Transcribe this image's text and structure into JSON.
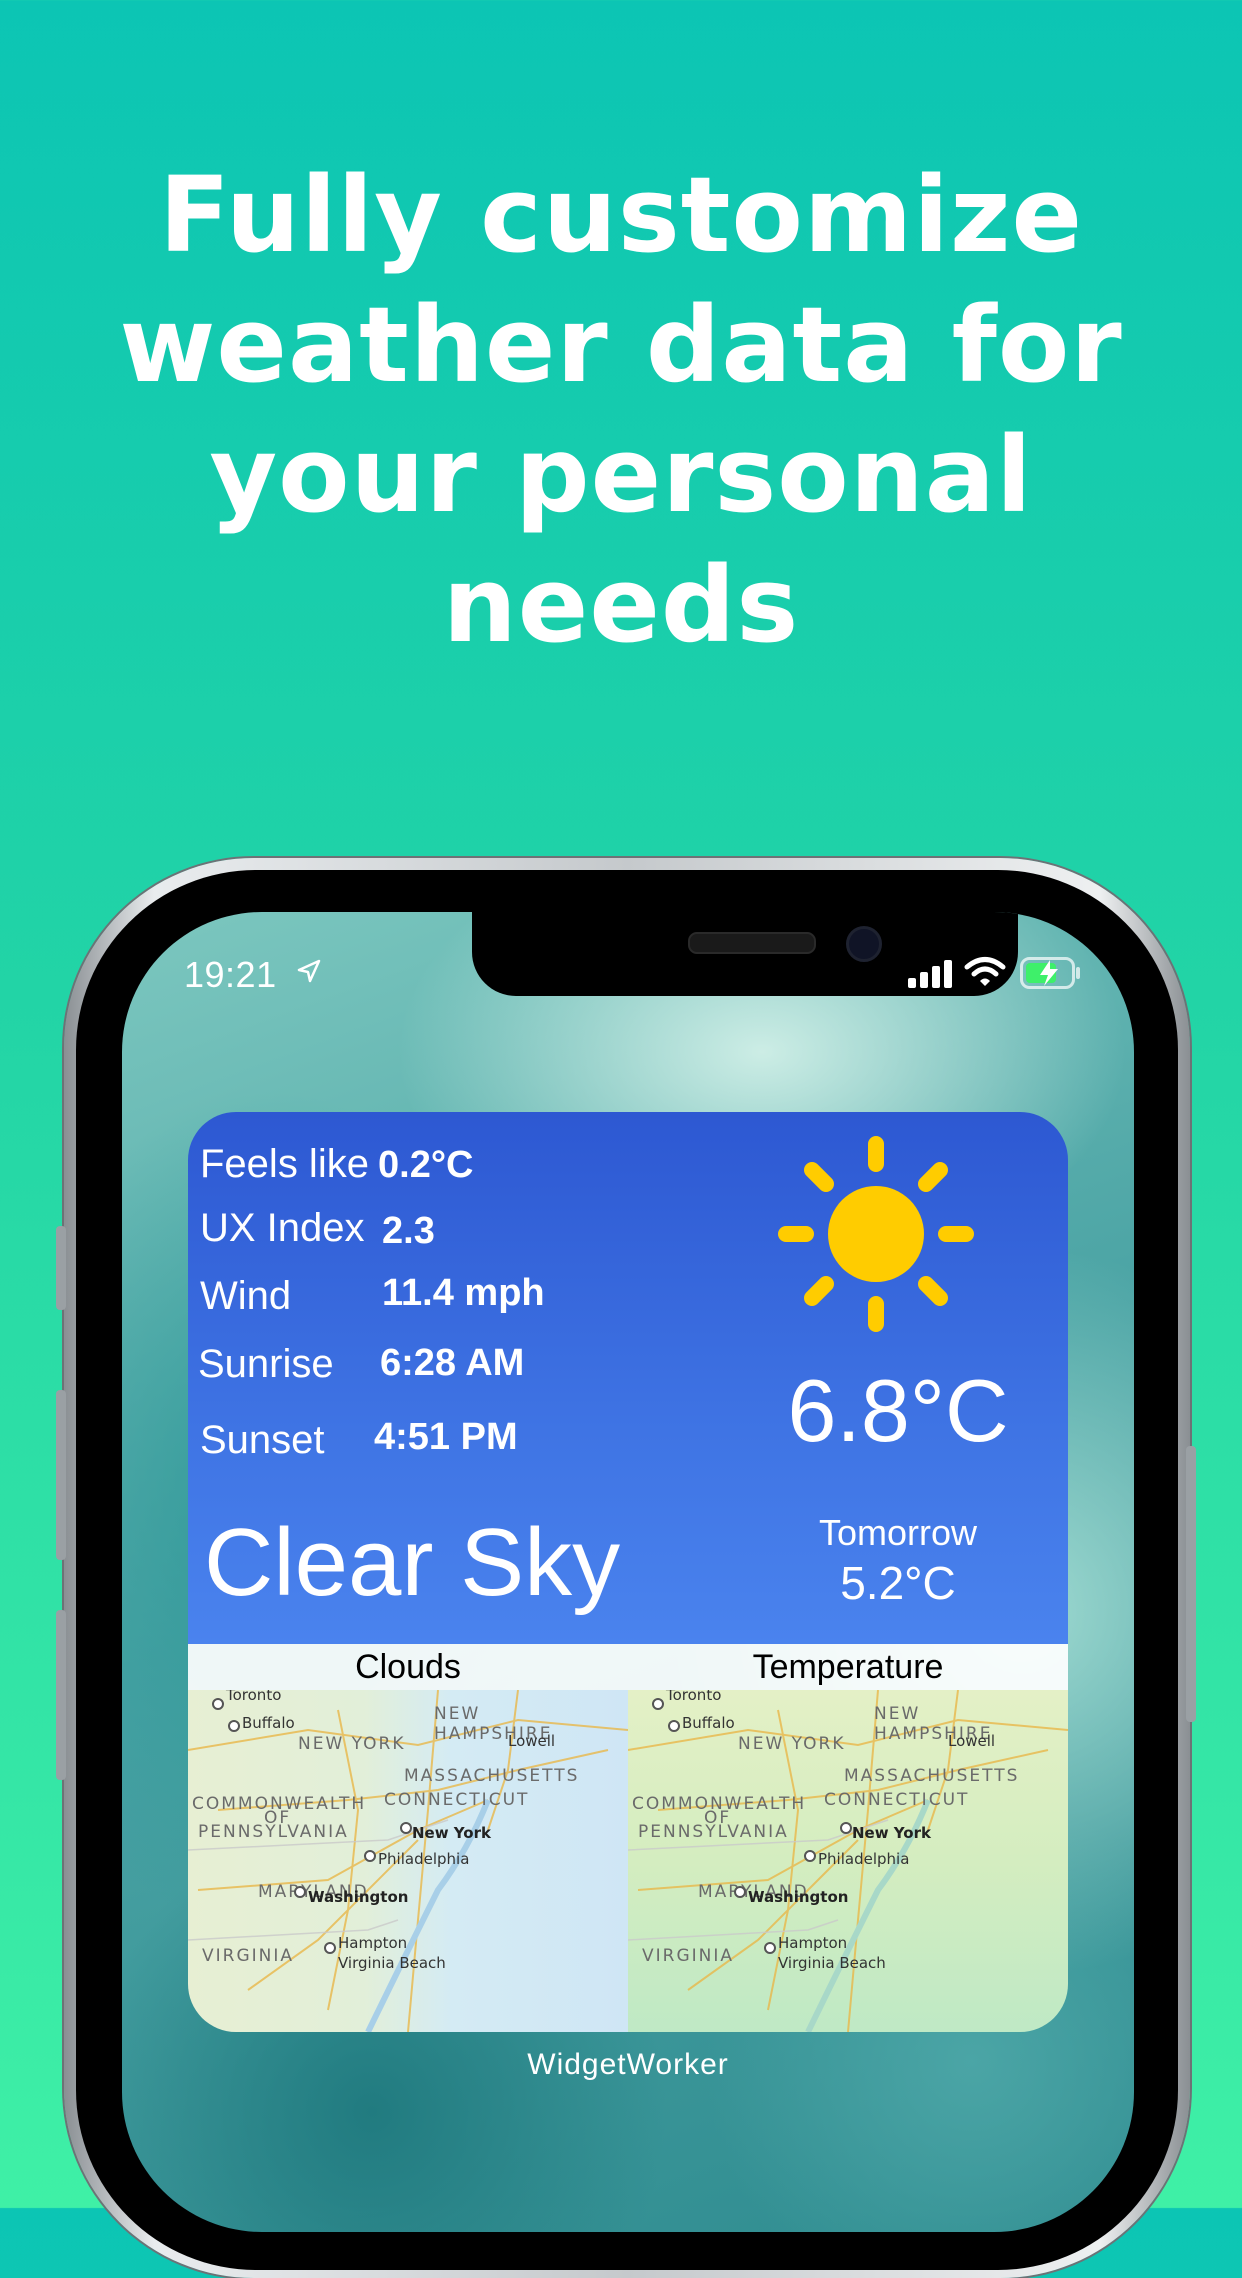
{
  "headline": [
    "Fully customize",
    "weather data for",
    "your personal",
    "needs"
  ],
  "status_bar": {
    "time": "19:21"
  },
  "widget": {
    "rows": [
      {
        "label": "Feels like",
        "value": "0.2°C"
      },
      {
        "label": "UX Index",
        "value": "2.3"
      },
      {
        "label": "Wind",
        "value": "11.4 mph"
      },
      {
        "label": "Sunrise",
        "value": "6:28 AM"
      },
      {
        "label": "Sunset",
        "value": "4:51 PM"
      }
    ],
    "summary": "Clear Sky",
    "current_temp": "6.8°C",
    "tomorrow_label": "Tomorrow",
    "tomorrow_temp": "5.2°C",
    "weather_icon": "sun-icon",
    "maps": [
      {
        "title": "Clouds"
      },
      {
        "title": "Temperature"
      }
    ],
    "map_labels": {
      "new_hampshire": "NEW HAMPSHIRE",
      "new_york_state": "NEW YORK",
      "massachusetts": "MASSACHUSETTS",
      "connecticut": "CONNECTICUT",
      "commonwealth": "COMMONWEALTH",
      "of": "OF",
      "pennsylvania": "PENNSYLVANIA",
      "maryland": "MARYLAND",
      "virginia": "VIRGINIA",
      "toronto": "Toronto",
      "buffalo": "Buffalo",
      "lowell": "Lowell",
      "new_york": "New York",
      "philadelphia": "Philadelphia",
      "washington": "Washington",
      "hampton": "Hampton",
      "virginia_beach": "Virginia Beach"
    },
    "caption": "WidgetWorker"
  },
  "colors": {
    "background_top": "#0cc5b4",
    "background_bottom": "#3ff0a6",
    "widget_blue": "#3f74e4",
    "sun_yellow": "#ffcc00"
  }
}
